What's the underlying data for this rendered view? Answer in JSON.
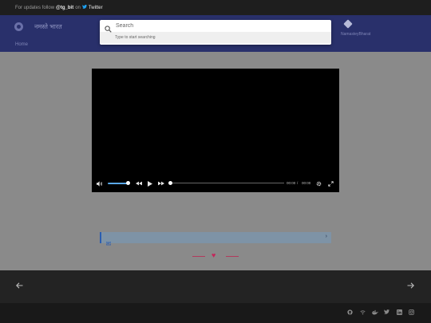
{
  "topbar": {
    "prefix": "For updates follow",
    "handle": "@tg_bit",
    "on": "on",
    "network": "Twitter",
    "bird_icon": "twitter-icon"
  },
  "header": {
    "title": "नमस्ते भारत",
    "nav_home": "Home",
    "repo_label": "NamasteyBharat",
    "repo_icon": "git-icon",
    "logo_icon": "site-logo-icon"
  },
  "search": {
    "placeholder": "Search",
    "hint": "Type to start searching"
  },
  "player": {
    "current_time": "00:00",
    "separator": "/",
    "duration": "00:00",
    "volume_level": 0.85,
    "progress": 0.0
  },
  "info_bar": {
    "icon": "comment-icon",
    "chevron": "›"
  },
  "divider": {
    "heart_icon": "heart-icon"
  },
  "bottom_nav": {
    "prev_icon": "arrow-left-icon",
    "next_icon": "arrow-right-icon"
  },
  "footer": {
    "icons": [
      "github-icon",
      "wifi-icon",
      "docker-icon",
      "twitter-icon",
      "linkedin-icon",
      "instagram-icon"
    ]
  },
  "colors": {
    "header_bg": "#29306b",
    "accent": "#2a5db0",
    "heart": "#c4265a",
    "overlay": "#8a8a8a"
  }
}
